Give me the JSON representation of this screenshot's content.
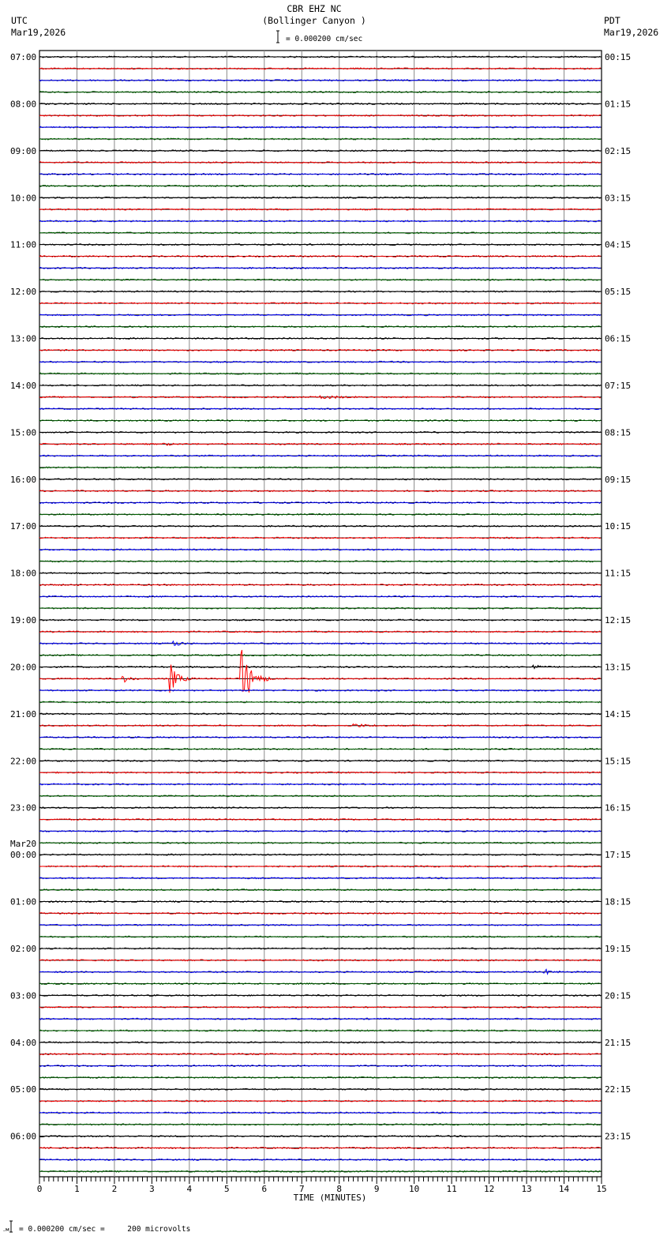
{
  "header": {
    "station": "CBR EHZ NC",
    "site": "(Bollinger Canyon )",
    "left_tz": "UTC",
    "left_date": "Mar19,2026",
    "right_tz": "PDT",
    "right_date": "Mar19,2026",
    "scale_text": "= 0.000200 cm/sec"
  },
  "footer": {
    "scale_text": "= 0.000200 cm/sec =     200 microvolts"
  },
  "chart_data": {
    "type": "line",
    "title": "CBR EHZ NC (Bollinger Canyon )",
    "xlabel": "TIME (MINUTES)",
    "xlim": [
      0,
      15
    ],
    "x_ticks": [
      "0",
      "1",
      "2",
      "3",
      "4",
      "5",
      "6",
      "7",
      "8",
      "9",
      "10",
      "11",
      "12",
      "13",
      "14",
      "15"
    ],
    "traces_per_hour": 4,
    "trace_colors": [
      "#000000",
      "#ff0000",
      "#0000ff",
      "#006400"
    ],
    "date_change_label": "Mar20",
    "left_labels": [
      "07:00",
      "08:00",
      "09:00",
      "10:00",
      "11:00",
      "12:00",
      "13:00",
      "14:00",
      "15:00",
      "16:00",
      "17:00",
      "18:00",
      "19:00",
      "20:00",
      "21:00",
      "22:00",
      "23:00",
      "00:00",
      "01:00",
      "02:00",
      "03:00",
      "04:00",
      "05:00",
      "06:00"
    ],
    "right_labels": [
      "00:15",
      "01:15",
      "02:15",
      "03:15",
      "04:15",
      "05:15",
      "06:15",
      "07:15",
      "08:15",
      "09:15",
      "10:15",
      "11:15",
      "12:15",
      "13:15",
      "14:15",
      "15:15",
      "16:15",
      "17:15",
      "18:15",
      "19:15",
      "20:15",
      "21:15",
      "22:15",
      "23:15"
    ],
    "events": [
      {
        "trace": 50,
        "minute": 3.6,
        "amplitude": 4,
        "duration": 0.6
      },
      {
        "trace": 52,
        "minute": 13.2,
        "amplitude": 3,
        "duration": 0.5
      },
      {
        "trace": 53,
        "minute": 2.25,
        "amplitude": 5,
        "duration": 0.5
      },
      {
        "trace": 53,
        "minute": 3.5,
        "amplitude": 18,
        "duration": 0.7
      },
      {
        "trace": 53,
        "minute": 5.4,
        "amplitude": 40,
        "duration": 0.9
      },
      {
        "trace": 57,
        "minute": 8.4,
        "amplitude": 2,
        "duration": 1.2
      },
      {
        "trace": 78,
        "minute": 13.5,
        "amplitude": 3,
        "duration": 0.6
      },
      {
        "trace": 33,
        "minute": 3.4,
        "amplitude": 4,
        "duration": 0.2
      },
      {
        "trace": 29,
        "minute": 7.5,
        "amplitude": 2,
        "duration": 1.5
      }
    ]
  }
}
